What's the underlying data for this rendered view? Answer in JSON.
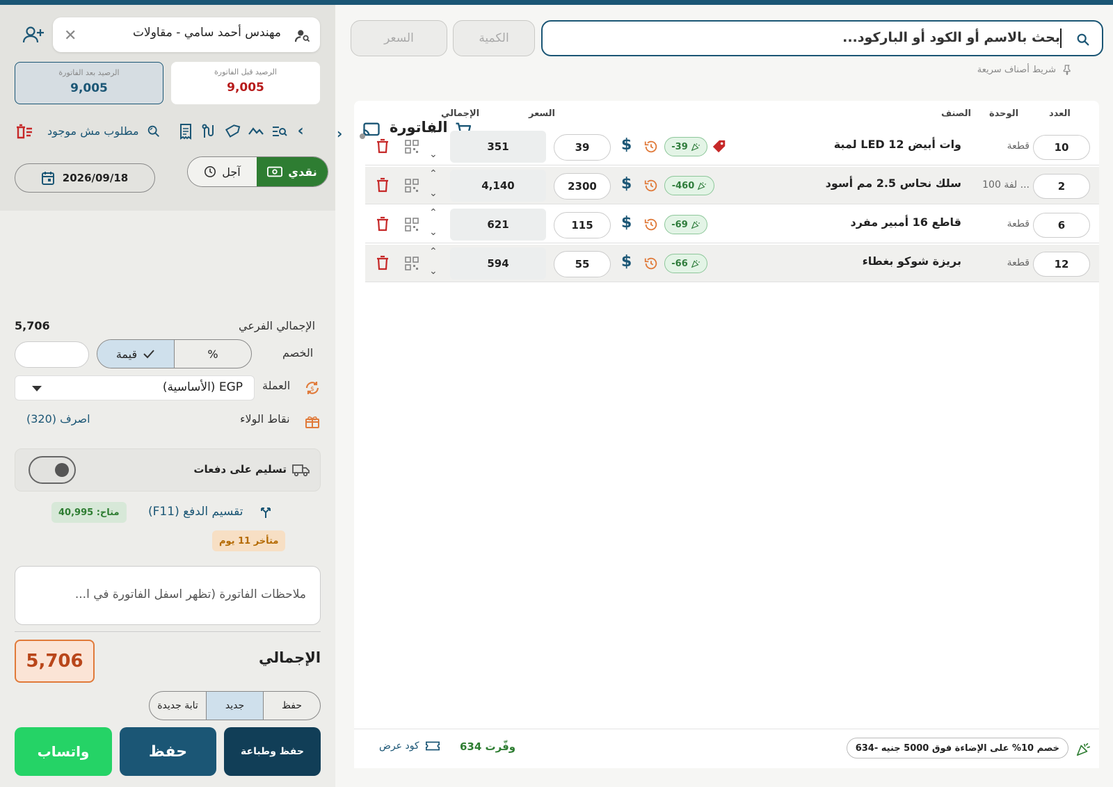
{
  "search": {
    "placeholder": "بحث بالاسم أو الكود أو الباركود...",
    "qty_label": "الكمية",
    "price_label": "السعر"
  },
  "quick_bar": {
    "label": "شريط أصناف سريعة"
  },
  "table": {
    "title": "الفاتورة",
    "headers": {
      "count": "العدد",
      "unit": "الوحدة",
      "item": "الصنف",
      "price": "السعر",
      "total": "الإجمالي"
    },
    "rows": [
      {
        "count": "10",
        "unit": "قطعة",
        "item": "لمبة LED 12 وات أبيض",
        "discount": "-39",
        "price": "39",
        "total": "351",
        "tagged": true
      },
      {
        "count": "2",
        "unit": "لفة 100 ...",
        "item": "سلك نحاس 2.5 مم أسود",
        "discount": "-460",
        "price": "2300",
        "total": "4,140",
        "tagged": false
      },
      {
        "count": "6",
        "unit": "قطعة",
        "item": "قاطع 16 أمبير مفرد",
        "discount": "-69",
        "price": "115",
        "total": "621",
        "tagged": false
      },
      {
        "count": "12",
        "unit": "قطعة",
        "item": "بريزة شوكو بغطاء",
        "discount": "-66",
        "price": "55",
        "total": "594",
        "tagged": false
      }
    ]
  },
  "footer": {
    "promo": "خصم 10% على الإضاءة فوق 5000 جنيه -634",
    "saved": "وفّرت 634",
    "promo_code": "كود عرض"
  },
  "customer": {
    "name": "مهندس أحمد سامي - مقاولات"
  },
  "balance": {
    "before_label": "الرصيد قبل الفاتورة",
    "before_value": "9,005",
    "after_label": "الرصيد بعد الفاتورة",
    "after_value": "9,005"
  },
  "missing": {
    "label": "مطلوب مش موجود"
  },
  "payment": {
    "cash": "نقدي",
    "credit": "آجل"
  },
  "date": {
    "value": "2026/09/18"
  },
  "summary": {
    "subtotal_label": "الإجمالي الفرعي",
    "subtotal_value": "5,706",
    "discount_label": "الخصم",
    "discount_percent": "%",
    "discount_value_mode": "قيمة",
    "currency_label": "العملة",
    "currency_value": "EGP (الأساسية)",
    "loyalty_label": "نقاط الولاء",
    "loyalty_action": "اصرف (320)"
  },
  "delivery": {
    "label": "تسليم على دفعات"
  },
  "split": {
    "label": "تقسيم الدفع (F11)",
    "available": "متاح: 40,995",
    "late": "متأخر 11 يوم"
  },
  "notes": {
    "placeholder": "ملاحظات الفاتورة (تظهر اسفل الفاتورة في ا..."
  },
  "grand": {
    "label": "الإجمالي",
    "value": "5,706"
  },
  "modes": {
    "save": "حفظ",
    "new": "جديد",
    "new_tab": "تابة جديدة"
  },
  "actions": {
    "save_print": "حفظ وطباعة",
    "save": "حفظ",
    "whatsapp": "واتساب"
  },
  "colors": {
    "primary": "#1b5675",
    "cash_green": "#2e7d32",
    "whatsapp": "#25d366",
    "danger": "#c62828",
    "accent_orange": "#e07a3a"
  }
}
